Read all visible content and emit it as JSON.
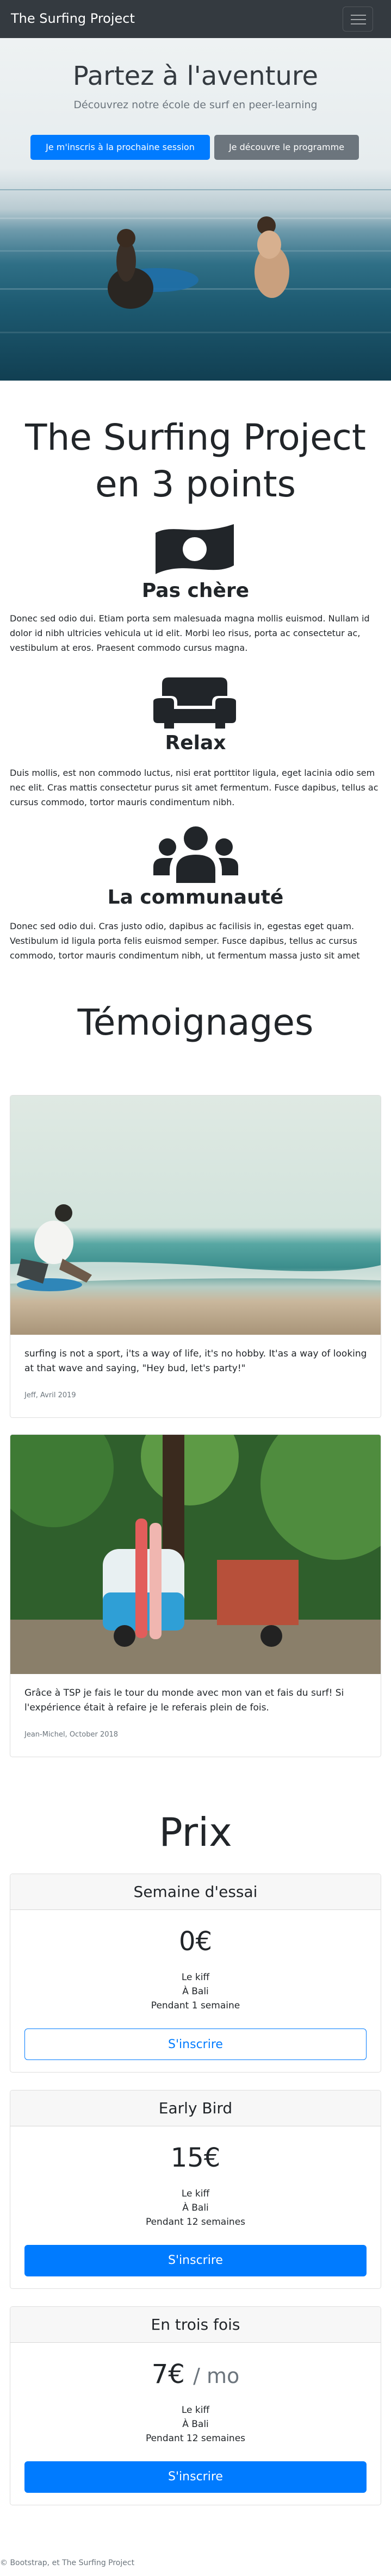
{
  "navbar": {
    "brand": "The Surfing Project",
    "toggler_icon": "hamburger-icon"
  },
  "hero": {
    "title": "Partez à l'aventure",
    "lead": "Découvrez notre école de surf en peer-learning",
    "primary_button": "Je m'inscris à la prochaine session",
    "secondary_button": "Je découvre le programme"
  },
  "features": {
    "title": "The Surfing Project en 3 points",
    "items": [
      {
        "icon": "money-bill-icon",
        "title": "Pas chère",
        "text": "Donec sed odio dui. Etiam porta sem malesuada magna mollis euismod. Nullam id dolor id nibh ultricies vehicula ut id elit. Morbi leo risus, porta ac consectetur ac, vestibulum at eros. Praesent commodo cursus magna."
      },
      {
        "icon": "couch-icon",
        "title": "Relax",
        "text": "Duis mollis, est non commodo luctus, nisi erat porttitor ligula, eget lacinia odio sem nec elit. Cras mattis consectetur purus sit amet fermentum. Fusce dapibus, tellus ac cursus commodo, tortor mauris condimentum nibh."
      },
      {
        "icon": "users-icon",
        "title": "La communauté",
        "text": "Donec sed odio dui. Cras justo odio, dapibus ac facilisis in, egestas eget quam. Vestibulum id ligula porta felis euismod semper. Fusce dapibus, tellus ac cursus commodo, tortor mauris condimentum nibh, ut fermentum massa justo sit amet risus."
      }
    ]
  },
  "testimonials": {
    "title": "Témoignages",
    "items": [
      {
        "text": "surfing is not a sport, i'ts a way of life, it's no hobby. It'as a way of looking at that wave and saying, \"Hey bud, let's party!\"",
        "author": "Jeff, Avril 2019"
      },
      {
        "text": "Grâce à TSP je fais le tour du monde avec mon van et fais du surf! Si l'expérience était à refaire je le referais plein de fois.",
        "author": "Jean-Michel, October 2018"
      }
    ]
  },
  "pricing": {
    "title": "Prix",
    "plans": [
      {
        "name": "Semaine d'essai",
        "price": "0€",
        "unit": "",
        "features": [
          "Le kiff",
          "À Bali",
          "Pendant 1 semaine"
        ],
        "button": "S'inscrire",
        "style": "outline"
      },
      {
        "name": "Early Bird",
        "price": "15€",
        "unit": "",
        "features": [
          "Le kiff",
          "À Bali",
          "Pendant 12 semaines"
        ],
        "button": "S'inscrire",
        "style": "solid"
      },
      {
        "name": "En trois fois",
        "price": "7€",
        "unit": "/ mo",
        "features": [
          "Le kiff",
          "À Bali",
          "Pendant 12 semaines"
        ],
        "button": "S'inscrire",
        "style": "solid"
      }
    ]
  },
  "footer": {
    "text": "© Bootstrap, et The Surfing Project"
  },
  "colors": {
    "navbar": "#343a40",
    "primary": "#007bff",
    "secondary": "#6c757d",
    "card_header": "#f7f7f7"
  }
}
